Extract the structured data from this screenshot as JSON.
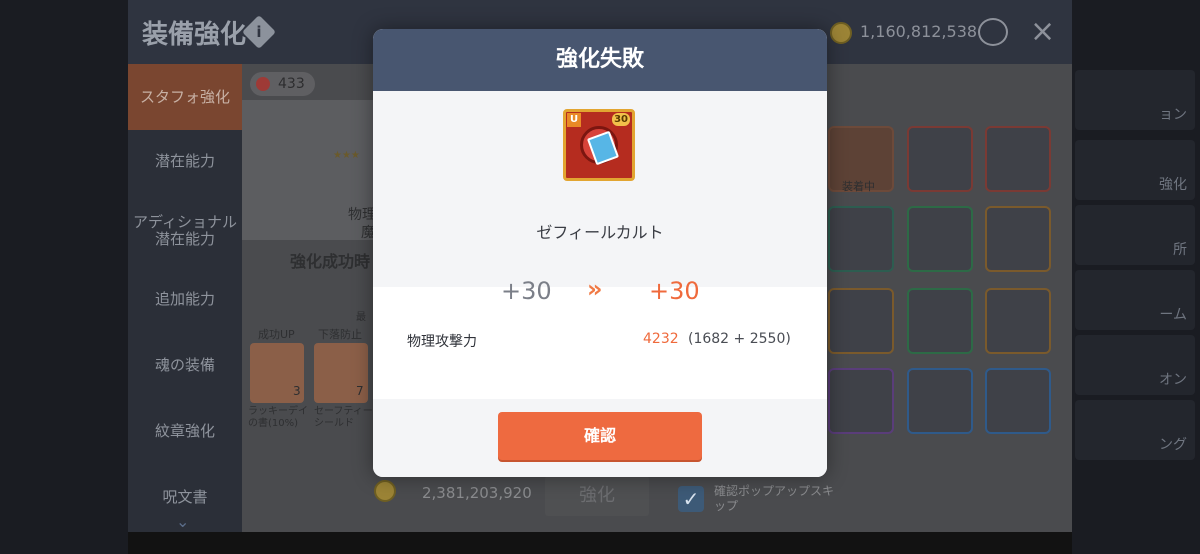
{
  "header": {
    "title": "装備強化",
    "currency": "1,160,812,538",
    "close_icon": "×"
  },
  "sidebar": {
    "items": [
      {
        "label": "スタフォ強化",
        "active": true
      },
      {
        "label": "潜在能力"
      },
      {
        "label": "アディショナル潜在能力"
      },
      {
        "label": "追加能力"
      },
      {
        "label": "魂の装備"
      },
      {
        "label": "紋章強化"
      },
      {
        "label": "呪文書"
      }
    ]
  },
  "main": {
    "star_count": "433",
    "text_physical": "物理",
    "text_magic": "魔",
    "success_rate_label": "強化成功時",
    "label_small": "最",
    "scrolls": [
      {
        "tag": "成功UP",
        "count": "3",
        "name": "ラッキーデイの書(10%)"
      },
      {
        "tag": "下落防止",
        "count": "7",
        "name": "セーフティーシールド"
      }
    ],
    "cost": "2,381,203,920",
    "enhance_button": "強化",
    "skip_popup": "確認ポップアップスキップ",
    "equipped_label": "装着中"
  },
  "right_bg": {
    "labels": [
      "ョン",
      "強化",
      "所",
      "ーム",
      "オン",
      "ング"
    ]
  },
  "modal": {
    "title": "強化失敗",
    "item_name": "ゼフィールカルト",
    "item_level": "30",
    "item_grade": "U",
    "level_before": "+30",
    "level_after": "+30",
    "arrows": "»",
    "stat_label": "物理攻撃力",
    "stat_value": "4232",
    "stat_breakdown": "(1682 + 2550)",
    "confirm_button": "確認"
  },
  "colors": {
    "accent": "#ee6a40",
    "modal_header": "#485670",
    "grade_badge": "#e98a26"
  }
}
